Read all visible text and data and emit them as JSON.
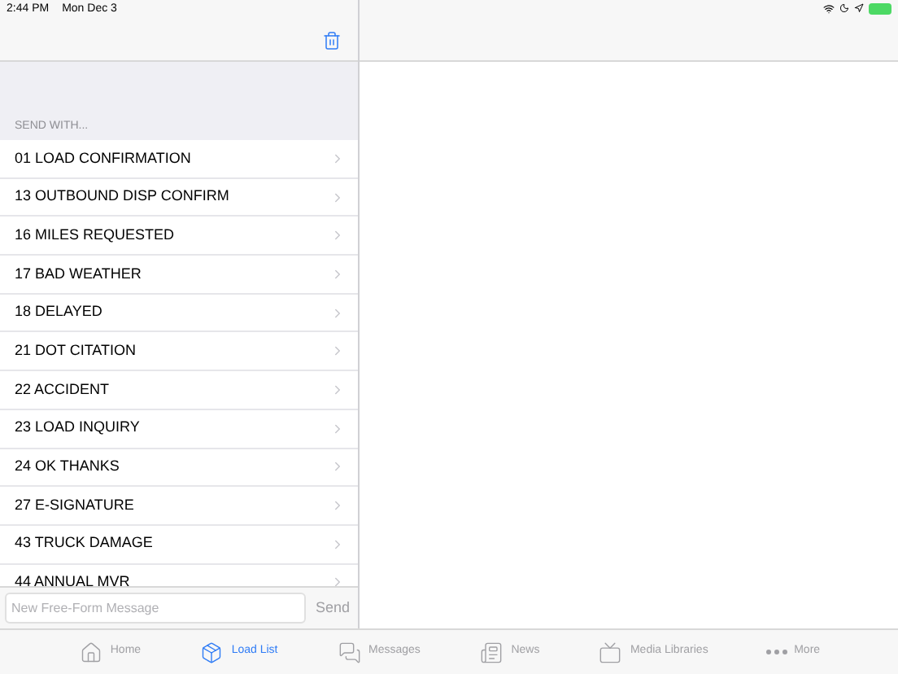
{
  "status_bar": {
    "time": "2:44 PM",
    "date": "Mon Dec 3"
  },
  "section_header": "SEND WITH...",
  "forms": [
    {
      "label": "01 LOAD CONFIRMATION"
    },
    {
      "label": "13 OUTBOUND DISP CONFIRM"
    },
    {
      "label": "16 MILES REQUESTED"
    },
    {
      "label": "17 BAD WEATHER"
    },
    {
      "label": "18 DELAYED"
    },
    {
      "label": "21 DOT CITATION"
    },
    {
      "label": "22 ACCIDENT"
    },
    {
      "label": "23 LOAD INQUIRY"
    },
    {
      "label": "24 OK THANKS"
    },
    {
      "label": "27 E-SIGNATURE"
    },
    {
      "label": "43 TRUCK DAMAGE"
    },
    {
      "label": "44 ANNUAL MVR"
    }
  ],
  "message_field": {
    "placeholder": "New Free-Form Message"
  },
  "send_button": "Send",
  "tabs": [
    {
      "kind": "home",
      "label": "Home",
      "selected": false
    },
    {
      "kind": "box",
      "label": "Load List",
      "selected": true
    },
    {
      "kind": "chat",
      "label": "Messages",
      "selected": false
    },
    {
      "kind": "news",
      "label": "News",
      "selected": false
    },
    {
      "kind": "tv",
      "label": "Media Libraries",
      "selected": false
    },
    {
      "kind": "more",
      "label": "More",
      "selected": false
    }
  ]
}
